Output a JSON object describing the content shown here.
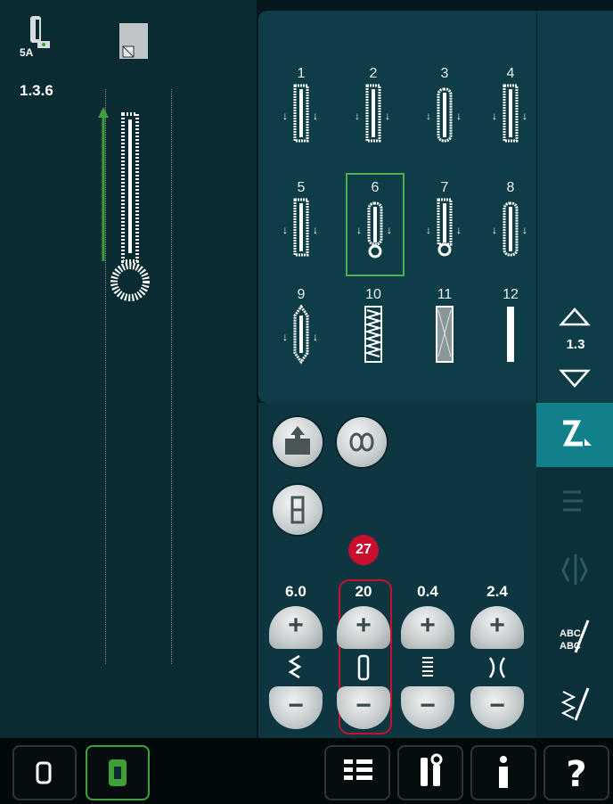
{
  "presser_foot": {
    "label": "5A"
  },
  "stitch_number": "1.3.6",
  "patterns": [
    {
      "number": "1"
    },
    {
      "number": "2"
    },
    {
      "number": "3"
    },
    {
      "number": "4"
    },
    {
      "number": "5"
    },
    {
      "number": "6",
      "selected": true
    },
    {
      "number": "7"
    },
    {
      "number": "8"
    },
    {
      "number": "9"
    },
    {
      "number": "10"
    },
    {
      "number": "11"
    },
    {
      "number": "12"
    }
  ],
  "menu_page": "1.3",
  "settings": {
    "width": {
      "value": "6.0",
      "icon": "stitch-width-icon"
    },
    "length": {
      "value": "20",
      "icon": "buttonhole-length-icon"
    },
    "density": {
      "value": "0.4",
      "icon": "stitch-density-icon"
    },
    "positioning": {
      "value": "2.4",
      "icon": "stitch-positioning-icon"
    }
  },
  "callout": {
    "label": "27"
  },
  "colors": {
    "accent_green": "#3fa03a",
    "callout_red": "#c8102e",
    "selected_border": "#4caf50",
    "active_tab": "#11808a"
  }
}
